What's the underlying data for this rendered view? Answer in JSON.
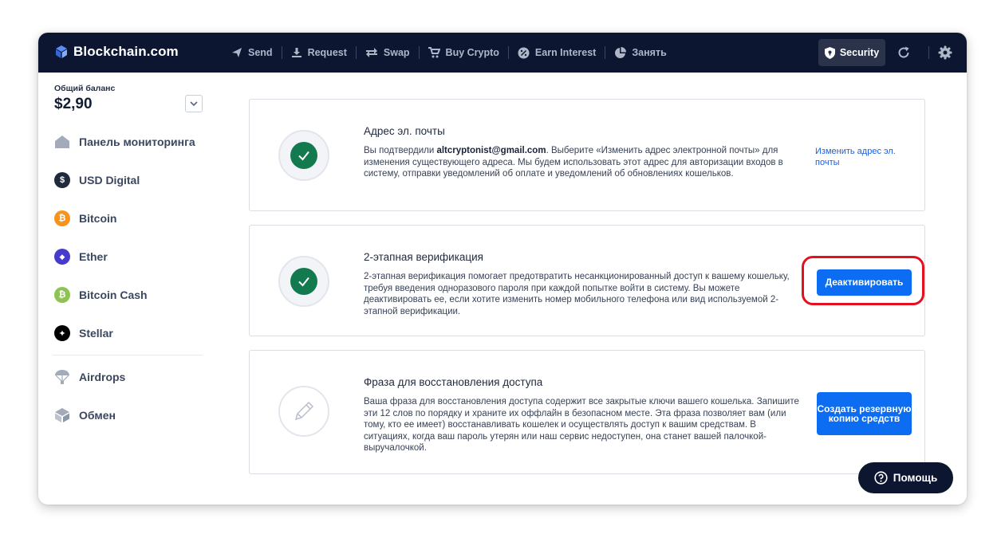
{
  "app": {
    "brand": "Blockchain.com"
  },
  "topnav": {
    "items": [
      {
        "label": "Send",
        "icon": "send-icon"
      },
      {
        "label": "Request",
        "icon": "download-icon"
      },
      {
        "label": "Swap",
        "icon": "swap-arrows-icon"
      },
      {
        "label": "Buy Crypto",
        "icon": "cart-icon"
      },
      {
        "label": "Earn Interest",
        "icon": "percent-icon"
      },
      {
        "label": "Занять",
        "icon": "pie-chart-icon"
      }
    ],
    "security_label": "Security"
  },
  "sidebar": {
    "balance_label": "Общий баланс",
    "balance_value": "$2,90",
    "items": [
      {
        "label": "Панель мониторинга",
        "icon": "home-icon"
      },
      {
        "label": "USD Digital",
        "icon": "usd-digital-icon",
        "glyph": "$",
        "color": "#1f2a3d"
      },
      {
        "label": "Bitcoin",
        "icon": "bitcoin-icon",
        "glyph": "₿",
        "color": "#f7931a"
      },
      {
        "label": "Ether",
        "icon": "ether-icon",
        "glyph": "◆",
        "color": "#473bcb"
      },
      {
        "label": "Bitcoin Cash",
        "icon": "bitcoin-cash-icon",
        "glyph": "₿",
        "color": "#8dc351"
      },
      {
        "label": "Stellar",
        "icon": "stellar-icon",
        "glyph": "✦",
        "color": "#000000"
      }
    ],
    "extra_items": [
      {
        "label": "Airdrops",
        "icon": "parachute-icon"
      },
      {
        "label": "Обмен",
        "icon": "exchange-icon"
      }
    ]
  },
  "cards": {
    "email": {
      "title": "Адрес эл. почты",
      "text_prefix": "Вы подтвердили ",
      "email": "altcryptonist@gmail.com",
      "text_suffix": ". Выберите «Изменить адрес электронной почты» для изменения существующего адреса. Мы будем использовать этот адрес для авторизации входов в систему, отправки уведомлений об оплате и уведомлений об обновлениях кошельков.",
      "action_link": "Изменить адрес эл. почты"
    },
    "twofa": {
      "title": "2-этапная верификация",
      "text": "2-этапная верификация помогает предотвратить несанкционированный доступ к вашему кошельку, требуя введения одноразового пароля при каждой попытке войти в систему. Вы можете деактивировать ее, если хотите изменить номер мобильного телефона или вид используемой 2-этапной верификации.",
      "button": "Деактивировать"
    },
    "recovery": {
      "title": "Фраза для восстановления доступа",
      "text": "Ваша фраза для восстановления доступа содержит все закрытые ключи вашего кошелька. Запишите эти 12 слов по порядку и храните их оффлайн в безопасном месте. Эта фраза позволяет вам (или тому, кто ее имеет) восстанавливать кошелек и осуществлять доступ к вашим средствам.  В ситуациях, когда ваш пароль утерян или наш сервис недоступен, она станет вашей палочкой-выручалочкой.",
      "button": "Создать резервную копию средств"
    }
  },
  "help": {
    "label": "Помощь"
  },
  "colors": {
    "topbar": "#0c1630",
    "accent": "#0c6cf2",
    "highlight": "#e3101f",
    "verified": "#137a4f"
  }
}
